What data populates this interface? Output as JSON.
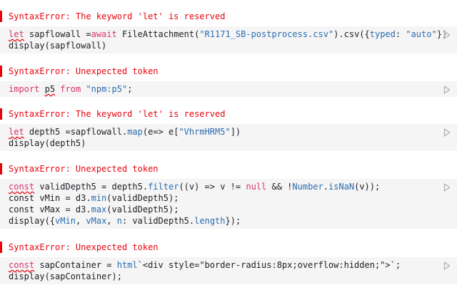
{
  "cells": [
    {
      "error": "SyntaxError: The keyword 'let' is reserved",
      "lines": [
        [
          {
            "t": "let",
            "c": "kw err-ul"
          },
          {
            "t": " sapflowall =",
            "c": ""
          },
          {
            "t": "await",
            "c": "kw"
          },
          {
            "t": " FileAttachment(",
            "c": ""
          },
          {
            "t": "\"R1171_SB-postprocess.csv\"",
            "c": "str"
          },
          {
            "t": ").csv({",
            "c": ""
          },
          {
            "t": "typed",
            "c": "str"
          },
          {
            "t": ": ",
            "c": ""
          },
          {
            "t": "\"auto\"",
            "c": "str"
          },
          {
            "t": "})",
            "c": ""
          }
        ],
        [
          {
            "t": "display(sapflowall)",
            "c": ""
          }
        ]
      ]
    },
    {
      "error": "SyntaxError: Unexpected token",
      "lines": [
        [
          {
            "t": "import",
            "c": "kw"
          },
          {
            "t": " ",
            "c": ""
          },
          {
            "t": "p5",
            "c": "err-ul"
          },
          {
            "t": " ",
            "c": ""
          },
          {
            "t": "from",
            "c": "kw"
          },
          {
            "t": " ",
            "c": ""
          },
          {
            "t": "\"npm:p5\"",
            "c": "str"
          },
          {
            "t": ";",
            "c": ""
          }
        ]
      ]
    },
    {
      "error": "SyntaxError: The keyword 'let' is reserved",
      "lines": [
        [
          {
            "t": "let",
            "c": "kw err-ul"
          },
          {
            "t": " depth5 =sapflowall.",
            "c": ""
          },
          {
            "t": "map",
            "c": "str"
          },
          {
            "t": "(e=> e[",
            "c": ""
          },
          {
            "t": "\"VhrmHRM5\"",
            "c": "str"
          },
          {
            "t": "])",
            "c": ""
          }
        ],
        [
          {
            "t": "display(depth5)",
            "c": ""
          }
        ]
      ]
    },
    {
      "error": "SyntaxError: Unexpected token",
      "lines": [
        [
          {
            "t": "const",
            "c": "kw err-ul"
          },
          {
            "t": " validDepth5 = depth5.",
            "c": ""
          },
          {
            "t": "filter",
            "c": "str"
          },
          {
            "t": "((v) => v != ",
            "c": ""
          },
          {
            "t": "null",
            "c": "kw"
          },
          {
            "t": " && !",
            "c": ""
          },
          {
            "t": "Number",
            "c": "str"
          },
          {
            "t": ".",
            "c": ""
          },
          {
            "t": "isNaN",
            "c": "str"
          },
          {
            "t": "(v));",
            "c": ""
          }
        ],
        [
          {
            "t": "const vMin = d3.",
            "c": ""
          },
          {
            "t": "min",
            "c": "str"
          },
          {
            "t": "(validDepth5);",
            "c": ""
          }
        ],
        [
          {
            "t": "const vMax = d3.",
            "c": ""
          },
          {
            "t": "max",
            "c": "str"
          },
          {
            "t": "(validDepth5);",
            "c": ""
          }
        ],
        [
          {
            "t": "display({",
            "c": ""
          },
          {
            "t": "vMin",
            "c": "str"
          },
          {
            "t": ", ",
            "c": ""
          },
          {
            "t": "vMax",
            "c": "str"
          },
          {
            "t": ", ",
            "c": ""
          },
          {
            "t": "n",
            "c": "str"
          },
          {
            "t": ": validDepth5.",
            "c": ""
          },
          {
            "t": "length",
            "c": "str"
          },
          {
            "t": "});",
            "c": ""
          }
        ]
      ]
    },
    {
      "error": "SyntaxError: Unexpected token",
      "lines": [
        [
          {
            "t": "const",
            "c": "kw err-ul"
          },
          {
            "t": " sapContainer = ",
            "c": ""
          },
          {
            "t": "html",
            "c": "str"
          },
          {
            "t": "`<div style=\"border-radius:8px;overflow:hidden;\">`;",
            "c": ""
          }
        ],
        [
          {
            "t": "display(sapContainer);",
            "c": ""
          }
        ]
      ]
    }
  ],
  "run_icon": "play-icon",
  "colors": {
    "error": "#e7040f",
    "keyword": "#d6336c",
    "string": "#2b6cb0",
    "code_bg": "#f5f5f5",
    "run_icon": "#b0b0b0"
  }
}
